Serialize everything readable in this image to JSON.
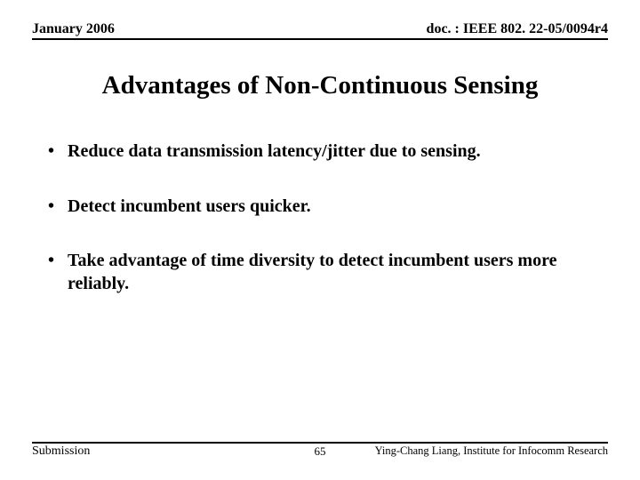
{
  "header": {
    "left": "January 2006",
    "right": "doc. : IEEE 802. 22-05/0094r4"
  },
  "title": "Advantages of Non-Continuous Sensing",
  "bullets": [
    "Reduce data transmission latency/jitter due to sensing.",
    "Detect incumbent users quicker.",
    "Take advantage of time diversity to detect incumbent users more reliably."
  ],
  "footer": {
    "left": "Submission",
    "center": "65",
    "right": "Ying-Chang Liang, Institute for Infocomm Research"
  }
}
